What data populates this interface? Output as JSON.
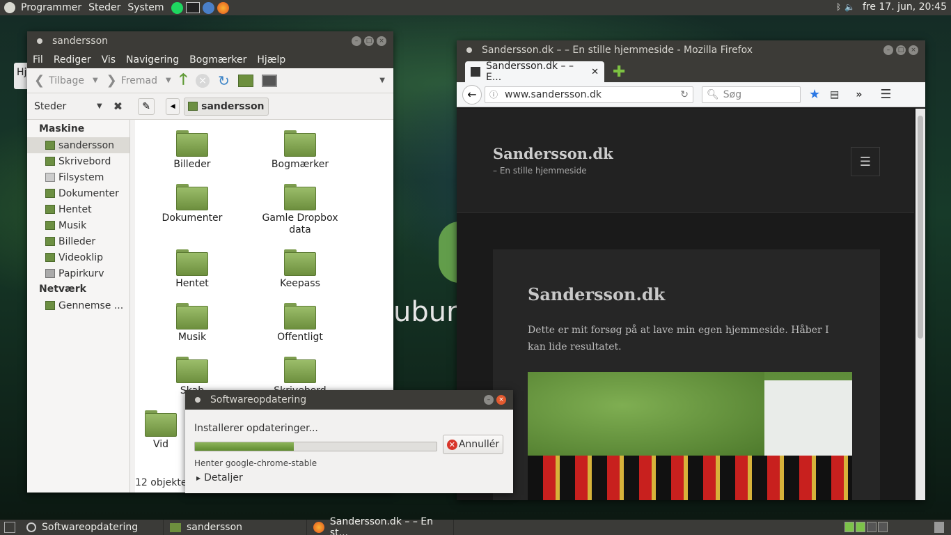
{
  "top_panel": {
    "menus": [
      "Programmer",
      "Steder",
      "System"
    ],
    "clock": "fre 17. jun, 20:45",
    "tray": [
      "bluetooth-icon",
      "volume-icon"
    ]
  },
  "desktop": {
    "partial_label": "Hj"
  },
  "file_manager": {
    "title": "sandersson",
    "menu": [
      "Fil",
      "Rediger",
      "Vis",
      "Navigering",
      "Bogmærker",
      "Hjælp"
    ],
    "toolbar": {
      "back": "Tilbage",
      "forward": "Fremad"
    },
    "location": {
      "places_label": "Steder",
      "crumb": "sandersson"
    },
    "sidebar": {
      "sections": [
        {
          "heading": "Maskine",
          "items": [
            "sandersson",
            "Skrivebord",
            "Filsystem",
            "Dokumenter",
            "Hentet",
            "Musik",
            "Billeder",
            "Videoklip",
            "Papirkurv"
          ]
        },
        {
          "heading": "Netværk",
          "items": [
            "Gennemse ..."
          ]
        }
      ]
    },
    "files": [
      "Billeder",
      "Bogmærker",
      "Dokumenter",
      "Gamle Dropbox data",
      "Hentet",
      "Keepass",
      "Musik",
      "Offentligt",
      "Skab",
      "Skrivebord",
      "Vid"
    ],
    "status": "12 objekte"
  },
  "firefox": {
    "title": "Sandersson.dk – – En stille hjemmeside - Mozilla Firefox",
    "tab_label": "Sandersson.dk – – E...",
    "url": "www.sandersson.dk",
    "search_placeholder": "Søg",
    "site_title": "Sandersson.dk",
    "tagline": "– En stille hjemmeside",
    "article_title": "Sandersson.dk",
    "article_text": "Dette er mit forsøg på at lave min egen hjemmeside. Håber I kan lide resultatet."
  },
  "dialog": {
    "title": "Softwareopdatering",
    "message": "Installerer opdateringer...",
    "progress": 0.41,
    "cancel_label": "Annullér",
    "status": "Henter google-chrome-stable",
    "details_label": "Detaljer"
  },
  "taskbar": {
    "tasks": [
      "Softwareopdatering",
      "sandersson",
      "Sandersson.dk – – En st..."
    ]
  }
}
